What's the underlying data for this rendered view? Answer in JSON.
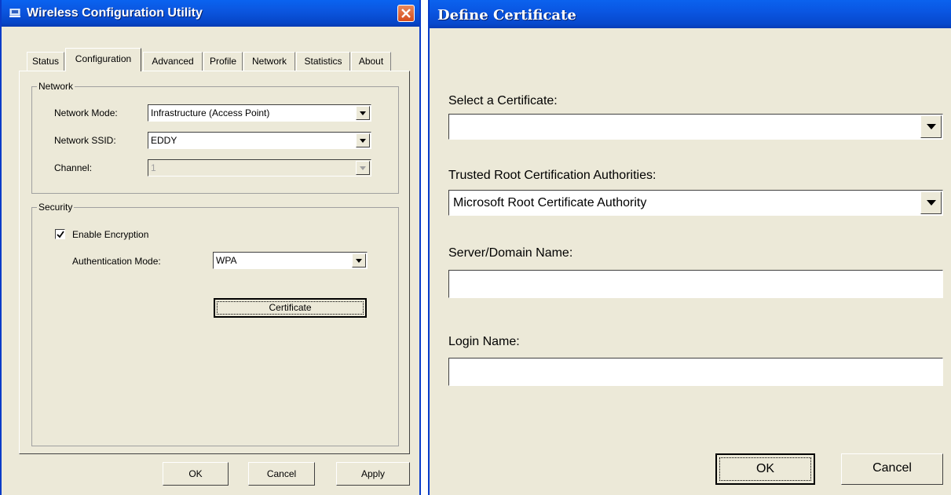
{
  "window1": {
    "title": "Wireless Configuration Utility",
    "tabs": [
      {
        "label": "Status"
      },
      {
        "label": "Configuration"
      },
      {
        "label": "Advanced"
      },
      {
        "label": "Profile"
      },
      {
        "label": "Network"
      },
      {
        "label": "Statistics"
      },
      {
        "label": "About"
      }
    ],
    "active_tab": "Configuration",
    "network_group": {
      "legend": "Network",
      "mode_label": "Network Mode:",
      "mode_value": "Infrastructure (Access Point)",
      "ssid_label": "Network SSID:",
      "ssid_value": "EDDY",
      "channel_label": "Channel:",
      "channel_value": "1"
    },
    "security_group": {
      "legend": "Security",
      "enable_encryption_label": "Enable Encryption",
      "enable_encryption_checked": true,
      "auth_mode_label": "Authentication Mode:",
      "auth_mode_value": "WPA",
      "certificate_button": "Certificate"
    },
    "buttons": {
      "ok": "OK",
      "cancel": "Cancel",
      "apply": "Apply"
    }
  },
  "window2": {
    "title": "Define Certificate",
    "select_cert_label": "Select a Certificate:",
    "select_cert_value": "",
    "trusted_root_label": "Trusted Root Certification Authorities:",
    "trusted_root_value": "Microsoft Root Certificate Authority",
    "server_label": "Server/Domain Name:",
    "server_value": "",
    "login_label": "Login Name:",
    "login_value": "",
    "buttons": {
      "ok": "OK",
      "cancel": "Cancel"
    }
  },
  "colors": {
    "titlebar": "#0a56e2",
    "window_bg": "#ece9d8",
    "close_button": "#d64d1c"
  }
}
